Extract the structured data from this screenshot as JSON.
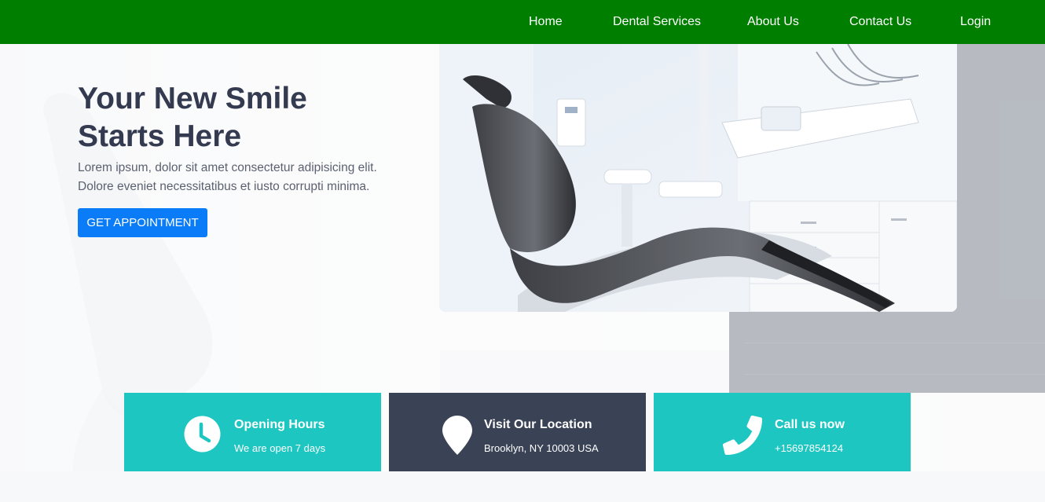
{
  "nav": {
    "items": [
      {
        "label": "Home"
      },
      {
        "label": "Dental Services"
      },
      {
        "label": "About Us"
      },
      {
        "label": "Contact Us"
      },
      {
        "label": "Login"
      }
    ]
  },
  "hero": {
    "title_line1": "Your New Smile",
    "title_line2": "Starts Here",
    "subtitle_line1": "Lorem ipsum, dolor sit amet consectetur adipisicing elit.",
    "subtitle_line2": "Dolore eveniet necessitatibus et iusto corrupti minima.",
    "cta_label": "GET APPOINTMENT"
  },
  "cards": [
    {
      "title": "Opening Hours",
      "text": "We are open 7 days",
      "icon": "clock-icon"
    },
    {
      "title": "Visit Our Location",
      "text": "Brooklyn, NY 10003 USA",
      "icon": "location-pin-icon"
    },
    {
      "title": "Call us now",
      "text": "+15697854124",
      "icon": "phone-icon"
    }
  ],
  "colors": {
    "navbar": "#007e00",
    "accent_teal": "#1dc6c1",
    "accent_dark": "#3a4256",
    "cta_blue": "#0b7cf7",
    "heading": "#343a50"
  }
}
